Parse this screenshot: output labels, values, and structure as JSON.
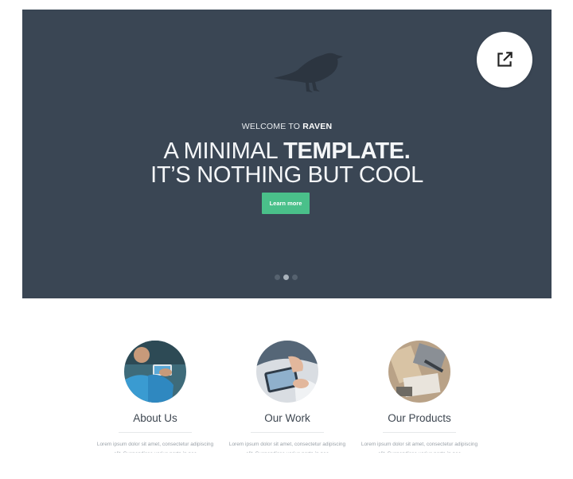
{
  "hero": {
    "welcome_prefix": "WELCOME TO ",
    "welcome_brand": "RAVEN",
    "headline_line1_light": "A MINIMAL ",
    "headline_line1_bold": "TEMPLATE.",
    "headline_line2": "IT’S NOTHING BUT COOL",
    "cta_label": "Learn more",
    "slide_count": 3,
    "active_slide": 2
  },
  "open_button": {
    "icon": "open-in-new-icon"
  },
  "features": [
    {
      "title": "About Us",
      "text": "Lorem ipsum dolor sit amet, consectetur adipiscing elit. Suspendisse varius porta in nec",
      "image": "phone-in-hands-photo"
    },
    {
      "title": "Our Work",
      "text": "Lorem ipsum dolor sit amet, consectetur adipiscing elit. Suspendisse varius porta in nec",
      "image": "tablet-in-hands-photo"
    },
    {
      "title": "Our Products",
      "text": "Lorem ipsum dolor sit amet, consectetur adipiscing elit. Suspendisse varius porta in nec",
      "image": "stationery-desk-photo"
    }
  ],
  "colors": {
    "hero_bg": "#3a4654",
    "accent": "#4ac08a",
    "text_dark": "#3d4650"
  }
}
